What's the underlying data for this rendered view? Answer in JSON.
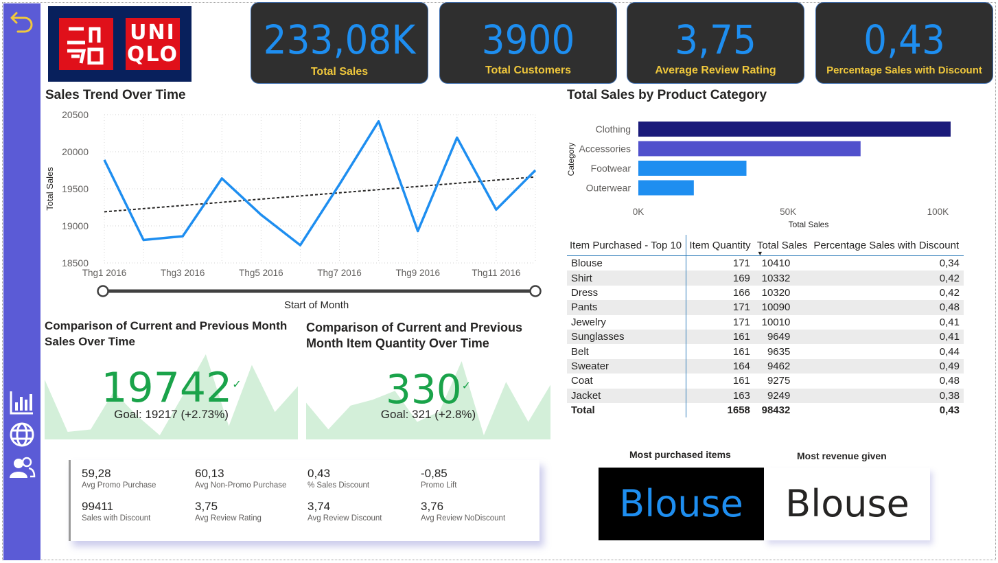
{
  "brand": {
    "logo_left": "ユニ\nクロ",
    "logo_right": "UNI\nQLO",
    "logo_bg": "#08205c",
    "logo_red": "#e0101a"
  },
  "sidebar": {
    "icons": [
      "back-arrow-icon",
      "bar-chart-icon",
      "globe-icon",
      "users-icon"
    ],
    "bg": "#5b5bd6"
  },
  "kpis": [
    {
      "value": "233,08K",
      "label": "Total Sales"
    },
    {
      "value": "3900",
      "label": "Total Customers"
    },
    {
      "value": "3,75",
      "label": "Average Review Rating"
    },
    {
      "value": "0,43",
      "label": "Percentage Sales with Discount"
    }
  ],
  "trend": {
    "title": "Sales Trend Over Time",
    "slider_label": "Start of Month",
    "chart_data": {
      "type": "line",
      "x": [
        "Thg1 2016",
        "Thg2 2016",
        "Thg3 2016",
        "Thg4 2016",
        "Thg5 2016",
        "Thg6 2016",
        "Thg7 2016",
        "Thg8 2016",
        "Thg9 2016",
        "Thg10 2016",
        "Thg11 2016",
        "Thg12 2016"
      ],
      "x_ticks": [
        "Thg1 2016",
        "Thg3 2016",
        "Thg5 2016",
        "Thg7 2016",
        "Thg9 2016",
        "Thg11 2016"
      ],
      "y": [
        19890,
        18810,
        18860,
        19640,
        19150,
        18740,
        19560,
        20410,
        18930,
        20190,
        19220,
        19750
      ],
      "trend_line": [
        19190,
        19660
      ],
      "ylabel": "Total Sales",
      "ylim": [
        18500,
        20500
      ],
      "y_ticks": [
        18500,
        19000,
        19500,
        20000,
        20500
      ],
      "line_color": "#1e8ef0",
      "grid": true
    }
  },
  "category": {
    "title": "Total Sales by Product Category",
    "chart_data": {
      "type": "bar",
      "categories": [
        "Clothing",
        "Accessories",
        "Footwear",
        "Outerwear"
      ],
      "values": [
        104264,
        74200,
        36093,
        18524
      ],
      "colors": [
        "#1a1a7a",
        "#5050cc",
        "#1e8ef0",
        "#1e8ef0"
      ],
      "xlabel": "Total Sales",
      "ylabel": "Category",
      "x_ticks": [
        "0K",
        "50K",
        "100K"
      ],
      "xlim": [
        0,
        110000
      ]
    }
  },
  "table": {
    "headers": [
      "Item Purchased - Top 10",
      "Item Quantity",
      "Total Sales",
      "Percentage Sales with Discount"
    ],
    "rows": [
      [
        "Blouse",
        "171",
        "10410",
        "0,34"
      ],
      [
        "Shirt",
        "169",
        "10332",
        "0,42"
      ],
      [
        "Dress",
        "166",
        "10320",
        "0,42"
      ],
      [
        "Pants",
        "171",
        "10090",
        "0,48"
      ],
      [
        "Jewelry",
        "171",
        "10010",
        "0,41"
      ],
      [
        "Sunglasses",
        "161",
        "9649",
        "0,41"
      ],
      [
        "Belt",
        "161",
        "9635",
        "0,44"
      ],
      [
        "Sweater",
        "164",
        "9462",
        "0,49"
      ],
      [
        "Coat",
        "161",
        "9275",
        "0,48"
      ],
      [
        "Jacket",
        "163",
        "9249",
        "0,38"
      ]
    ],
    "total": [
      "Total",
      "1658",
      "98432",
      "0,43"
    ]
  },
  "comparison_sales": {
    "title": "Comparison of Current and Previous Month Sales Over Time",
    "value": "19742",
    "goal": "Goal: 19217 (+2.73%)",
    "spark": [
      19890,
      18810,
      18860,
      19640,
      19150,
      18740,
      19560,
      20410,
      18930,
      20190,
      19220,
      19750
    ]
  },
  "comparison_qty": {
    "title": "Comparison of Current and Previous Month Item Quantity Over Time",
    "value": "330",
    "goal": "Goal: 321 (+2.8%)",
    "spark": [
      318,
      300,
      316,
      320,
      326,
      305,
      312,
      346,
      296,
      332,
      305,
      330
    ]
  },
  "multirow": [
    {
      "value": "59,28",
      "label": "Avg Promo Purchase"
    },
    {
      "value": "60,13",
      "label": "Avg Non-Promo Purchase"
    },
    {
      "value": "0,43",
      "label": "% Sales Discount"
    },
    {
      "value": "-0,85",
      "label": "Promo Lift"
    },
    {
      "value": "99411",
      "label": "Sales with Discount"
    },
    {
      "value": "3,75",
      "label": "Avg Review Rating"
    },
    {
      "value": "3,74",
      "label": "Avg Review Discount"
    },
    {
      "value": "3,76",
      "label": "Avg Review NoDiscount"
    }
  ],
  "most_purchased": {
    "title": "Most purchased items",
    "value": "Blouse"
  },
  "most_revenue": {
    "title": "Most revenue given",
    "value": "Blouse"
  }
}
